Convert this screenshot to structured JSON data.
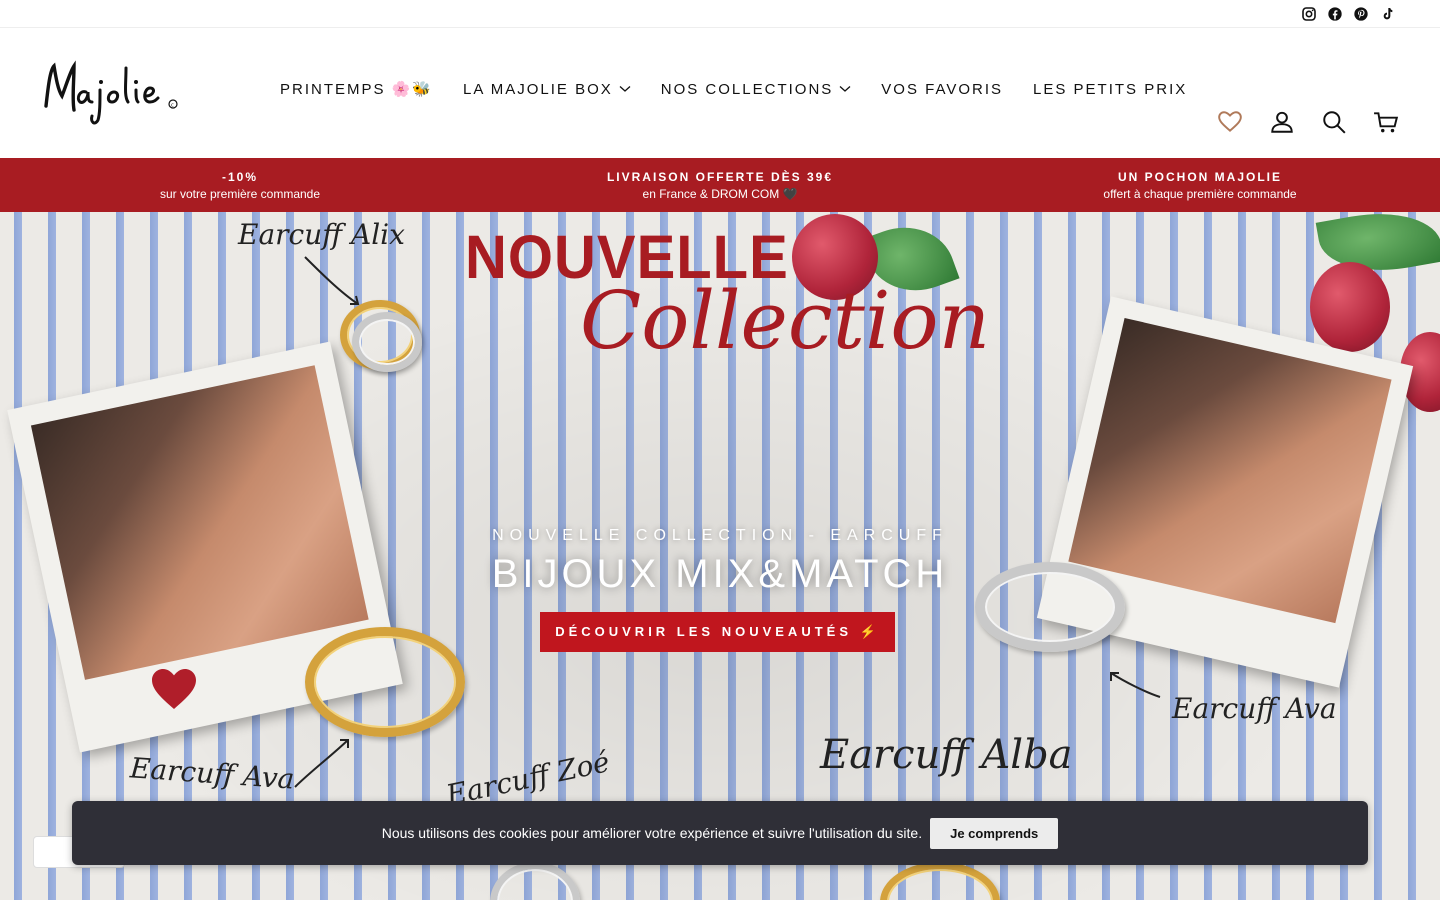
{
  "social": {
    "icons": [
      "instagram-icon",
      "facebook-icon",
      "pinterest-icon",
      "tiktok-icon"
    ]
  },
  "header": {
    "logo_text": "Majolie",
    "nav": [
      {
        "label": "PRINTEMPS 🌸🐝",
        "has_dropdown": false
      },
      {
        "label": "LA MAJOLIE BOX",
        "has_dropdown": true
      },
      {
        "label": "NOS COLLECTIONS",
        "has_dropdown": true
      },
      {
        "label": "VOS FAVORIS",
        "has_dropdown": false
      },
      {
        "label": "LES PETITS PRIX",
        "has_dropdown": false
      }
    ],
    "icons": [
      "heart-icon",
      "account-icon",
      "search-icon",
      "cart-icon"
    ]
  },
  "promo": [
    {
      "title": "-10%",
      "subtitle": "sur votre première commande"
    },
    {
      "title": "LIVRAISON OFFERTE DÈS 39€",
      "subtitle": "en France & DROM COM 🖤"
    },
    {
      "title": "UN POCHON MAJOLIE",
      "subtitle": "offert à chaque première commande"
    }
  ],
  "hero": {
    "title_top": "NOUVELLE",
    "title_script": "Collection",
    "labels": {
      "alix": "Earcuff Alix",
      "ava_left": "Earcuff Ava",
      "zoe": "Earcuff Zoé",
      "alba": "Earcuff Alba",
      "ava_right": "Earcuff Ava"
    },
    "subheading": "NOUVELLE COLLECTION - EARCUFF",
    "heading": "BIJOUX MIX&MATCH",
    "cta": "DÉCOUVRIR LES NOUVEAUTÉS ⚡"
  },
  "cookie": {
    "text": "Nous utilisons des cookies pour améliorer votre expérience et suivre l'utilisation du site.",
    "button": "Je comprends"
  },
  "colors": {
    "brand_red": "#a81c22",
    "cta_red": "#c0161e",
    "cookie_bg": "#2f2f37",
    "heart_accent": "#b07a5a"
  }
}
